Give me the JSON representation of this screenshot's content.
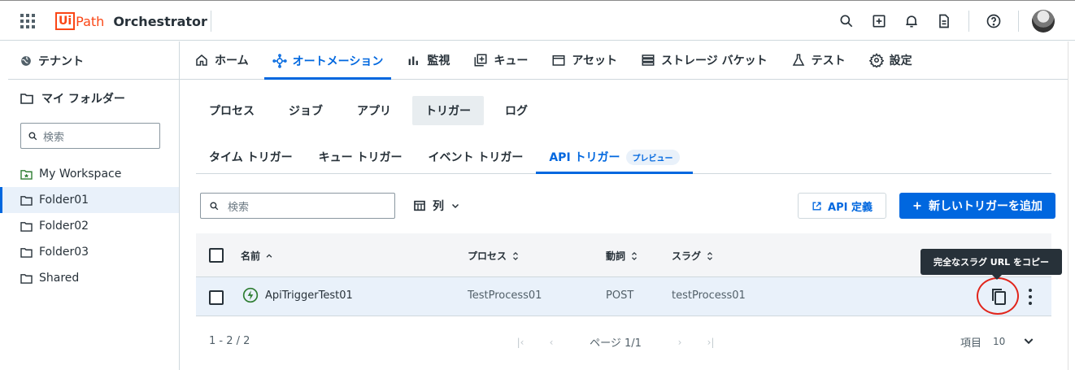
{
  "brand": {
    "logo_box": "Ui",
    "logo_path": "Path",
    "app_name": "Orchestrator",
    "accent": "#0067df",
    "logo_color": "#fa4616"
  },
  "topbar_icons": [
    "search-icon",
    "add-box-icon",
    "bell-icon",
    "document-icon",
    "help-icon",
    "avatar"
  ],
  "sidebar": {
    "tenant_label": "テナント",
    "my_folder_label": "マイ フォルダー",
    "search_placeholder": "検索",
    "folders": [
      {
        "label": "My Workspace",
        "icon": "workspace-folder-icon",
        "active": false
      },
      {
        "label": "Folder01",
        "icon": "folder-icon",
        "active": true
      },
      {
        "label": "Folder02",
        "icon": "folder-icon",
        "active": false
      },
      {
        "label": "Folder03",
        "icon": "folder-icon",
        "active": false
      },
      {
        "label": "Shared",
        "icon": "folder-icon",
        "active": false
      }
    ]
  },
  "main_nav": [
    {
      "label": "ホーム",
      "icon": "home-icon"
    },
    {
      "label": "オートメーション",
      "icon": "automation-icon",
      "active": true
    },
    {
      "label": "監視",
      "icon": "chart-icon"
    },
    {
      "label": "キュー",
      "icon": "queue-icon"
    },
    {
      "label": "アセット",
      "icon": "asset-icon"
    },
    {
      "label": "ストレージ バケット",
      "icon": "storage-icon"
    },
    {
      "label": "テスト",
      "icon": "flask-icon"
    },
    {
      "label": "設定",
      "icon": "gear-icon"
    }
  ],
  "sub_tabs": [
    {
      "label": "プロセス"
    },
    {
      "label": "ジョブ"
    },
    {
      "label": "アプリ"
    },
    {
      "label": "トリガー",
      "active": true
    },
    {
      "label": "ログ"
    }
  ],
  "trigger_tabs": [
    {
      "label": "タイム トリガー"
    },
    {
      "label": "キュー トリガー"
    },
    {
      "label": "イベント トリガー"
    },
    {
      "label": "API トリガー",
      "active": true,
      "badge": "プレビュー"
    }
  ],
  "toolbar": {
    "search_placeholder": "検索",
    "columns_label": "列",
    "api_def_label": "API 定義",
    "add_label": "新しいトリガーを追加"
  },
  "table": {
    "headers": {
      "name": "名前",
      "process": "プロセス",
      "verb": "動詞",
      "slug": "スラグ"
    },
    "rows": [
      {
        "name": "ApiTriggerTest01",
        "process": "TestProcess01",
        "verb": "POST",
        "slug": "testProcess01"
      }
    ]
  },
  "tooltip": "完全なスラグ URL をコピー",
  "footer": {
    "range": "1 - 2 / 2",
    "page_label": "ページ 1/1",
    "items_label": "項目",
    "items_value": "10"
  }
}
